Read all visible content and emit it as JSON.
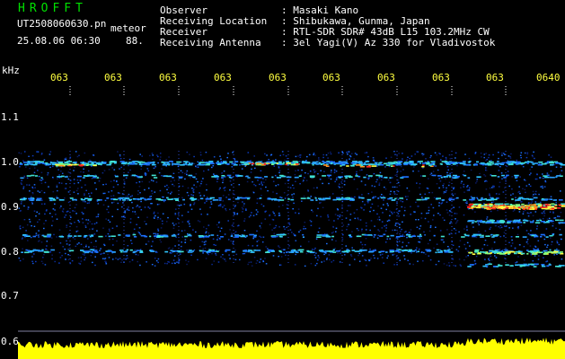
{
  "header": {
    "app_title": "HROFFT",
    "file_name": "UT2508060630.pn",
    "tag": "meteor",
    "datetime": "25.08.06 06:30",
    "value": "88."
  },
  "info": [
    {
      "label": "Observer",
      "value": ": Masaki Kano"
    },
    {
      "label": "Receiving Location",
      "value": ": Shibukawa, Gunma, Japan"
    },
    {
      "label": "Receiver",
      "value": ": RTL-SDR SDR# 43dB L15 103.2MHz CW"
    },
    {
      "label": "Receiving Antenna",
      "value": ": 3el Yagi(V) Az 330 for Vladivostok"
    }
  ],
  "axis": {
    "unit": "kHz",
    "y_ticks": [
      "1.1",
      "1.0",
      "0.9",
      "0.8",
      "0.7",
      "0.6"
    ],
    "x_ticks": [
      "063",
      "063",
      "063",
      "063",
      "063",
      "063",
      "063",
      "063",
      "063",
      "0640"
    ]
  },
  "colors": {
    "background": "#000000",
    "title": "#00e000",
    "x_ticks": "#ffff40",
    "signal_low": "#0a3cc8",
    "signal_high": "#ff2020",
    "power_trace": "#ffff00"
  }
}
